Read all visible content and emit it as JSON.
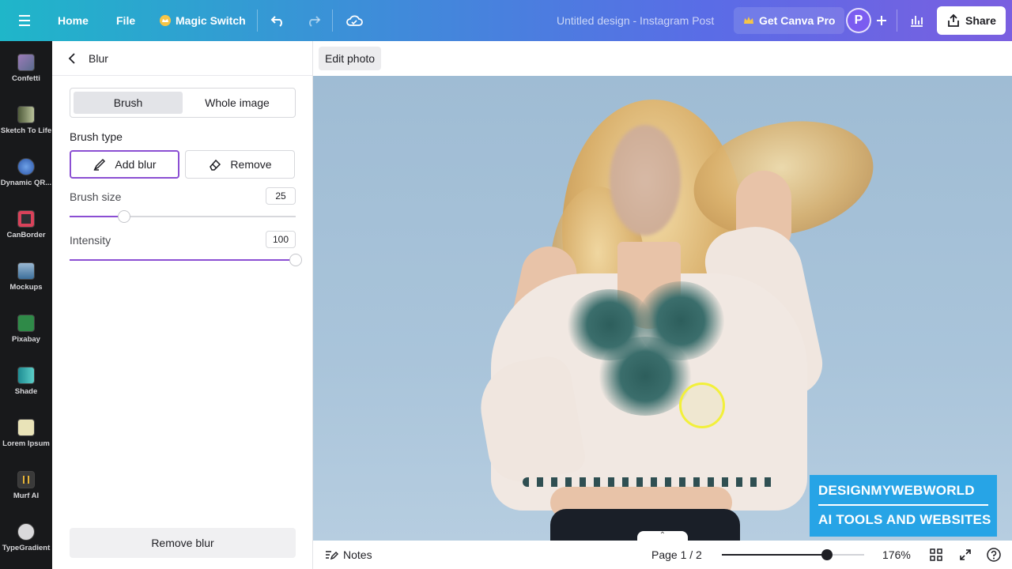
{
  "topbar": {
    "home": "Home",
    "file": "File",
    "magic_switch": "Magic Switch",
    "design_title": "Untitled design - Instagram Post",
    "get_pro": "Get Canva Pro",
    "avatar_initial": "P",
    "share": "Share"
  },
  "rail": {
    "items": [
      {
        "label": "Confetti",
        "icon": "confetti-icon"
      },
      {
        "label": "Sketch To Life",
        "icon": "sketch-icon"
      },
      {
        "label": "Dynamic QR...",
        "icon": "qr-icon"
      },
      {
        "label": "CanBorder",
        "icon": "border-icon"
      },
      {
        "label": "Mockups",
        "icon": "mockups-icon"
      },
      {
        "label": "Pixabay",
        "icon": "pixabay-icon"
      },
      {
        "label": "Shade",
        "icon": "shade-icon"
      },
      {
        "label": "Lorem Ipsum",
        "icon": "lorem-icon"
      },
      {
        "label": "Murf AI",
        "icon": "murf-icon"
      },
      {
        "label": "TypeGradient",
        "icon": "typegradient-icon"
      }
    ]
  },
  "panel": {
    "title": "Blur",
    "tabs": [
      "Brush",
      "Whole image"
    ],
    "brush_type_label": "Brush type",
    "add_blur": "Add blur",
    "remove": "Remove",
    "brush_size_label": "Brush size",
    "brush_size_value": "25",
    "brush_size_fraction": 0.24,
    "intensity_label": "Intensity",
    "intensity_value": "100",
    "intensity_fraction": 1.0,
    "remove_blur": "Remove blur"
  },
  "canvas": {
    "edit_photo": "Edit photo",
    "watermark_line1": "DESIGNMYWEBWORLD",
    "watermark_line2": "AI TOOLS AND WEBSITES"
  },
  "bottombar": {
    "notes": "Notes",
    "page": "Page 1 / 2",
    "zoom": "176%",
    "zoom_fraction": 0.74
  },
  "colors": {
    "accent": "#8b4fd3",
    "watermark": "#27a4e6"
  }
}
